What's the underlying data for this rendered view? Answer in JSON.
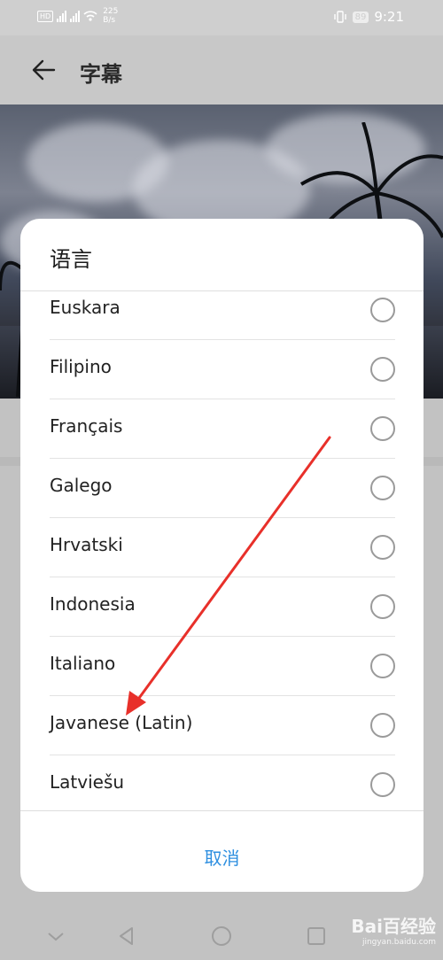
{
  "status_bar": {
    "hd": "HD",
    "net_speed_value": "225",
    "net_speed_unit": "B/s",
    "battery": "89",
    "time": "9:21"
  },
  "app_bar": {
    "title": "字幕"
  },
  "dialog": {
    "title": "语言",
    "languages": [
      {
        "label": "Euskara",
        "selected": false
      },
      {
        "label": "Filipino",
        "selected": false
      },
      {
        "label": "Français",
        "selected": false
      },
      {
        "label": "Galego",
        "selected": false
      },
      {
        "label": "Hrvatski",
        "selected": false
      },
      {
        "label": "Indonesia",
        "selected": false
      },
      {
        "label": "Italiano",
        "selected": false
      },
      {
        "label": "Javanese (Latin)",
        "selected": false
      },
      {
        "label": "Latviešu",
        "selected": false
      }
    ],
    "cancel_label": "取消"
  },
  "watermark": {
    "brand": "Bai百经验",
    "url": "jingyan.baidu.com"
  },
  "colors": {
    "accent": "#2e8fe0",
    "annotation_arrow": "#e8302a"
  }
}
